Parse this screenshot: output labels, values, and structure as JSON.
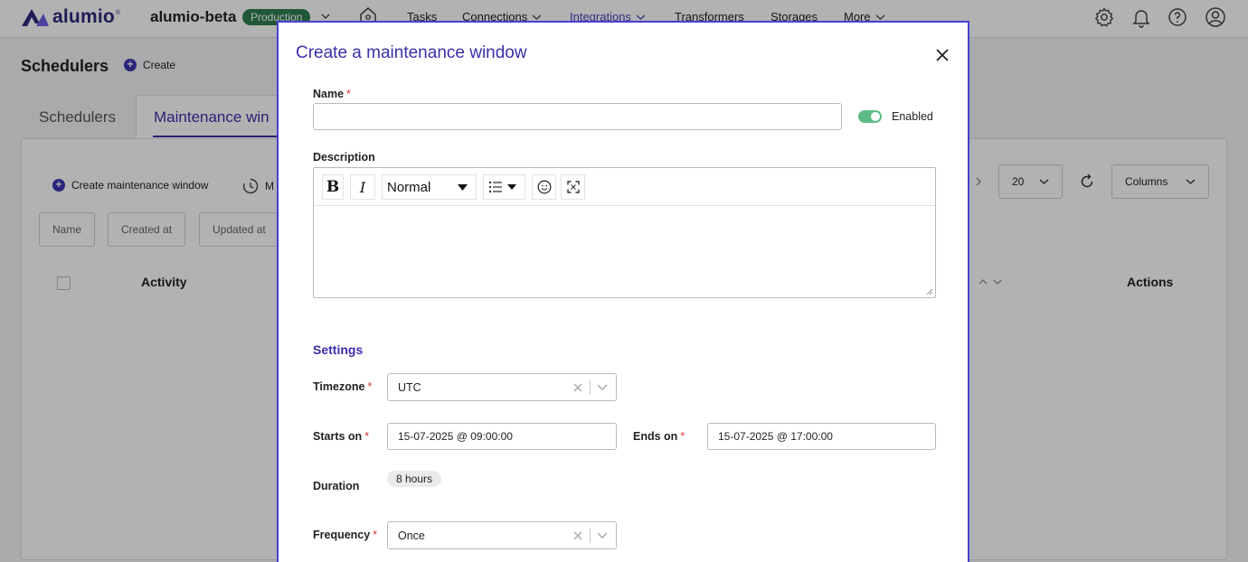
{
  "topbar": {
    "logo_text": "alumio",
    "logo_reg": "®",
    "environment_name": "alumio-beta",
    "environment_badge": "Production",
    "nav": {
      "tasks": "Tasks",
      "connections": "Connections",
      "integrations": "Integrations",
      "transformers": "Transformers",
      "storages": "Storages",
      "more": "More"
    },
    "accent_color": "#4b3fbf",
    "badge_color": "#2f7d4e"
  },
  "page": {
    "title": "Schedulers",
    "create_label": "Create",
    "tabs": [
      "Schedulers",
      "Maintenance win"
    ],
    "toolbar": {
      "create_maintenance_label": "Create maintenance window",
      "second_action_label": "M"
    },
    "filters": [
      "Name",
      "Created at",
      "Updated at"
    ],
    "page_size": "20",
    "columns_label": "Columns",
    "table_headers": {
      "activity": "Activity",
      "actions": "Actions"
    }
  },
  "modal": {
    "title": "Create a maintenance window",
    "name_label": "Name",
    "required_mark": "*",
    "name_value": "",
    "enabled_label": "Enabled",
    "enabled": true,
    "description_label": "Description",
    "editor": {
      "bold": "B",
      "italic": "I",
      "heading_select": "Normal"
    },
    "settings_title": "Settings",
    "timezone_label": "Timezone",
    "timezone_value": "UTC",
    "starts_on_label": "Starts on",
    "starts_on_value": "15-07-2025 @ 09:00:00",
    "ends_on_label": "Ends on",
    "ends_on_value": "15-07-2025 @ 17:00:00",
    "duration_label": "Duration",
    "duration_value": "8 hours",
    "frequency_label": "Frequency",
    "frequency_value": "Once"
  }
}
